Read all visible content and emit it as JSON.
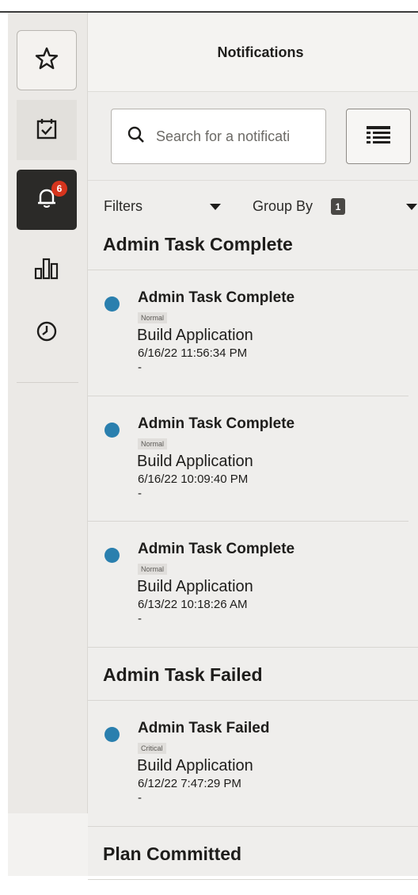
{
  "rail": {
    "items": [
      {
        "name": "favorites",
        "icon": "star-icon",
        "selected": false
      },
      {
        "name": "tasks",
        "icon": "calendar-check-icon",
        "selected": false
      },
      {
        "name": "notifications",
        "icon": "bell-icon",
        "selected": true,
        "badge": "6"
      },
      {
        "name": "reports",
        "icon": "bar-chart-icon",
        "selected": false
      },
      {
        "name": "recent",
        "icon": "clock-icon",
        "selected": false
      }
    ],
    "notification_badge": "6"
  },
  "panel": {
    "title": "Notifications",
    "search": {
      "placeholder": "Search for a notificati"
    },
    "filters_label": "Filters",
    "group_by_label": "Group By",
    "group_by_count": "1"
  },
  "groups": [
    {
      "title": "Admin Task Complete",
      "items": [
        {
          "title": "Admin Task Complete",
          "priority": "Normal",
          "subtitle": "Build Application",
          "timestamp": "6/16/22 11:56:34 PM",
          "extra": "-"
        },
        {
          "title": "Admin Task Complete",
          "priority": "Normal",
          "subtitle": "Build Application",
          "timestamp": "6/16/22 10:09:40 PM",
          "extra": "-"
        },
        {
          "title": "Admin Task Complete",
          "priority": "Normal",
          "subtitle": "Build Application",
          "timestamp": "6/13/22 10:18:26 AM",
          "extra": "-"
        }
      ]
    },
    {
      "title": "Admin Task Failed",
      "items": [
        {
          "title": "Admin Task Failed",
          "priority": "Critical",
          "subtitle": "Build Application",
          "timestamp": "6/12/22 7:47:29 PM",
          "extra": "-"
        }
      ]
    },
    {
      "title": "Plan Committed",
      "items": []
    }
  ],
  "colors": {
    "unread_dot": "#2a7fae",
    "badge": "#d6341d",
    "selected_rail": "#2b2a28",
    "panel_bg": "#efeeec",
    "rail_bg": "#ebe9e6"
  }
}
